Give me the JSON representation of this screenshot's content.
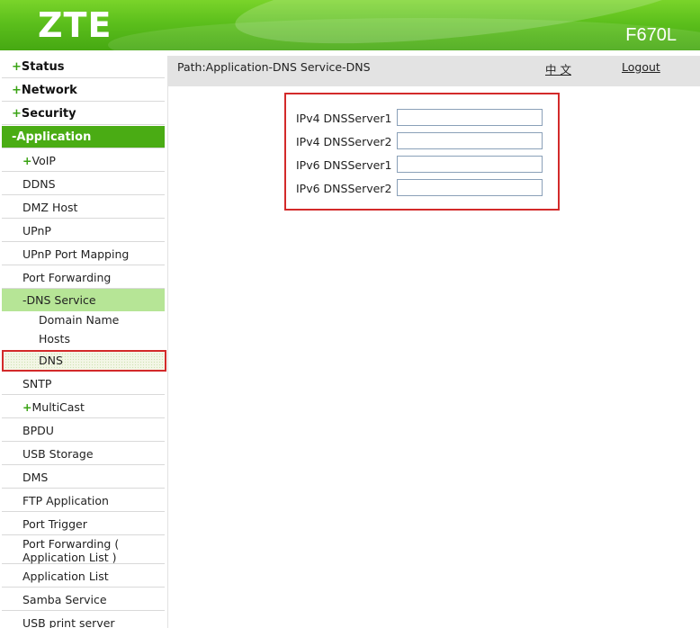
{
  "header": {
    "logo": "ZTE",
    "model": "F670L"
  },
  "pathbar": {
    "path": "Path:Application-DNS Service-DNS",
    "language": "中 文",
    "logout": "Logout"
  },
  "sidebar": {
    "status": "Status",
    "network": "Network",
    "security": "Security",
    "application": "Application",
    "voip": "VoIP",
    "ddns": "DDNS",
    "dmz_host": "DMZ Host",
    "upnp": "UPnP",
    "upnp_port_mapping": "UPnP Port Mapping",
    "port_forwarding": "Port Forwarding",
    "dns_service": "DNS Service",
    "domain_name": "Domain Name",
    "hosts": "Hosts",
    "dns": "DNS",
    "sntp": "SNTP",
    "multicast": "MultiCast",
    "bpdu": "BPDU",
    "usb_storage": "USB Storage",
    "dms": "DMS",
    "ftp_application": "FTP Application",
    "port_trigger": "Port Trigger",
    "port_forwarding_app_list_1": "Port Forwarding (",
    "port_forwarding_app_list_2": "Application List )",
    "application_list": "Application List",
    "samba_service": "Samba Service",
    "usb_print_server": "USB print server"
  },
  "form": {
    "ipv4_dns1": {
      "label": "IPv4 DNSServer1",
      "value": ""
    },
    "ipv4_dns2": {
      "label": "IPv4 DNSServer2",
      "value": ""
    },
    "ipv6_dns1": {
      "label": "IPv6 DNSServer1",
      "value": ""
    },
    "ipv6_dns2": {
      "label": "IPv6 DNSServer2",
      "value": ""
    }
  },
  "colors": {
    "brand_green": "#4aac14",
    "highlight_red": "#d32a2a",
    "submenu_green": "#b6e596"
  }
}
